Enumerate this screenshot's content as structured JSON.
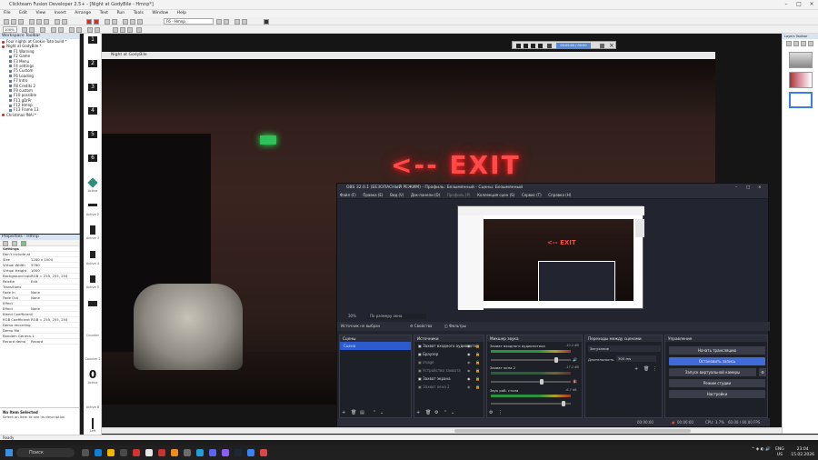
{
  "ct_window": {
    "title": "Clickteam Fusion Developer 2.5+ - [Night at GodyBile - Hmnp*]",
    "menu": [
      "File",
      "Edit",
      "View",
      "Insert",
      "Arrange",
      "Text",
      "Run",
      "Tools",
      "Window",
      "Help"
    ],
    "frame_dropdown": "F6 - Hmnp",
    "zoom": "100%"
  },
  "workspace": {
    "header": "Workspace Toolbar",
    "items": [
      {
        "label": "Four nights at Cookie Toto build *",
        "level": 0
      },
      {
        "label": "Night at GodyBile *",
        "level": 0
      },
      {
        "label": "F1 Warning",
        "level": 1
      },
      {
        "label": "F2 Game",
        "level": 1
      },
      {
        "label": "F3 Menu",
        "level": 1
      },
      {
        "label": "F4 settings",
        "level": 1
      },
      {
        "label": "F5 Custom",
        "level": 1
      },
      {
        "label": "F6 Loading",
        "level": 1
      },
      {
        "label": "F7 Intro",
        "level": 1
      },
      {
        "label": "F8 Credits 2",
        "level": 1
      },
      {
        "label": "F9 custom",
        "level": 1
      },
      {
        "label": "F10 possible",
        "level": 1
      },
      {
        "label": "F11 gDrPr",
        "level": 1
      },
      {
        "label": "F12 Hmnp",
        "level": 1
      },
      {
        "label": "F13 Frame 13",
        "level": 1
      },
      {
        "label": "Christmas fNAi *",
        "level": 0
      }
    ]
  },
  "properties": {
    "header": "Properties - Hmnp",
    "section_settings": "Settings",
    "rows": [
      {
        "k": "Don't include at build time",
        "v": ""
      },
      {
        "k": "Size",
        "v": "1280 x 1000"
      },
      {
        "k": "Virtual Width",
        "v": "5760"
      },
      {
        "k": "Virtual Height",
        "v": "1000"
      },
      {
        "k": "Background color",
        "v": "RGB = 255, 255, 255"
      },
      {
        "k": "Palette",
        "v": "Edit"
      }
    ],
    "section_transitions": "Transitions",
    "rows2": [
      {
        "k": "Fade In",
        "v": "None"
      },
      {
        "k": "Fade Out",
        "v": "None"
      }
    ],
    "section_effect": "Effect",
    "rows3": [
      {
        "k": "Effect",
        "v": "None"
      },
      {
        "k": "Blend Coefficient",
        "v": "0"
      },
      {
        "k": "RGB Coefficient",
        "v": "RGB = 255, 255, 255"
      }
    ],
    "section_demo": "Demo recording",
    "rows4": [
      {
        "k": "Demo file",
        "v": ""
      },
      {
        "k": "Random Generator",
        "v": "-1"
      },
      {
        "k": "Record demo",
        "v": "Record"
      }
    ],
    "no_item_title": "No Item Selected",
    "no_item_desc": "Select an item to see its description"
  },
  "frame_strip": {
    "numbers": [
      "1",
      "2",
      "3",
      "4",
      "5",
      "6"
    ],
    "labels": [
      "Active",
      "Active 2",
      "Active 3",
      "Active 4",
      "Active 5",
      "Counter",
      "Counter 2",
      "Active",
      "Active 8",
      "Left"
    ],
    "big_counter": "0"
  },
  "game": {
    "window_title": "Night at GodyBile",
    "exit_text": "<-- EXIT"
  },
  "media_bar": {
    "label": "00:00:00 / 00:00"
  },
  "obs": {
    "title": "OBS 32.0.1 (БЕЗОПАСНЫЙ РЕЖИМ) - Профиль: Безымянный - Сцены: Безымянный",
    "menu": [
      "Файл (F)",
      "Правка (E)",
      "Вид (V)",
      "Док-панели (D)",
      "Профиль (P)",
      "Коллекция сцен (S)",
      "Сервис (T)",
      "Справка (H)"
    ],
    "zoom": "30%",
    "zoom_mode": "По размеру окна",
    "no_source": "Источник не выбран",
    "props_label": "Свойства",
    "filters_label": "Фильтры",
    "scenes": {
      "header": "Сцены",
      "items": [
        "Сцена"
      ]
    },
    "sources": {
      "header": "Источники",
      "items": [
        "Захват входного аудиопото",
        "Браузер",
        "image",
        "Устройство захвата",
        "Захват экрана",
        "Захват окна 2"
      ]
    },
    "mixer": {
      "header": "Микшер звука",
      "ch1": "Захват входного аудиопотока",
      "ch1_db": "-10.2 dB",
      "ch2": "Захват окна 2",
      "ch2_db": "-17.2 dB",
      "ch3": "Звук раб. стола",
      "ch3_db": "-6.7 dB"
    },
    "transitions": {
      "header": "Переходы между сценами",
      "selected": "Затухание",
      "duration_label": "Длительность",
      "duration": "300 ms"
    },
    "controls": {
      "header": "Управление",
      "start_stream": "Начать трансляцию",
      "stop_record": "Остановить запись",
      "virtual_cam": "Запуск виртуальной камеры",
      "studio_mode": "Режим студии",
      "settings": "Настройки"
    },
    "status": {
      "rec_time": "00:00:00",
      "rec_time2": "00:00:00",
      "cpu": "CPU: 3.7%",
      "fps": "60.00 / 60.00 FPS"
    }
  },
  "ct_status": "Ready",
  "taskbar": {
    "search": "Поиск",
    "lang": "ENG",
    "lang2": "US",
    "time": "23:04",
    "date": "15.02.2026"
  },
  "colors": {
    "obs_accent": "#3f6ad8",
    "exit_red": "#ff4a4a",
    "exit_green": "#2fc25a"
  }
}
